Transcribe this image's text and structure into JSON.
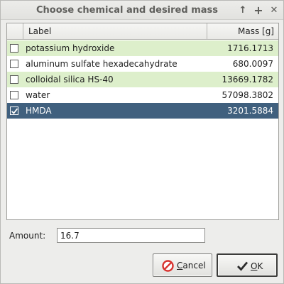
{
  "window": {
    "title": "Choose chemical and desired mass",
    "controls": [
      "up-arrow-icon",
      "maximize-icon",
      "close-icon"
    ]
  },
  "table": {
    "columns": {
      "label": "Label",
      "mass": "Mass [g]"
    },
    "rows": [
      {
        "label": "potassium hydroxide",
        "mass": "1716.1713",
        "checked": false,
        "color": "#ddefcb"
      },
      {
        "label": "aluminum sulfate hexadecahydrate",
        "mass": "680.0097",
        "checked": false,
        "color": "#ffffff"
      },
      {
        "label": "colloidal silica HS-40",
        "mass": "13669.1782",
        "checked": false,
        "color": "#ddefcb"
      },
      {
        "label": "water",
        "mass": "57098.3802",
        "checked": false,
        "color": "#ffffff"
      },
      {
        "label": "HMDA",
        "mass": "3201.5884",
        "checked": true,
        "selected": true,
        "color": "#40607e"
      }
    ]
  },
  "amount": {
    "label": "Amount:",
    "value": "16.7"
  },
  "buttons": {
    "cancel": {
      "mnemonic": "C",
      "rest": "ancel",
      "icon": "cancel-icon"
    },
    "ok": {
      "mnemonic": "O",
      "rest": "K",
      "icon": "checkmark-icon"
    }
  }
}
